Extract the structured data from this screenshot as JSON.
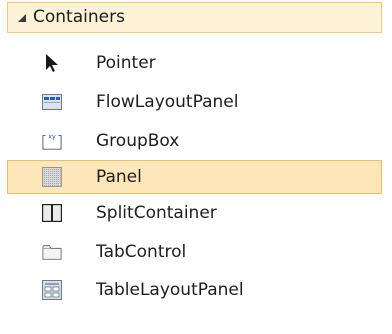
{
  "toolbox": {
    "group": {
      "label": "Containers",
      "expander_icon": "expanded-triangle-icon"
    },
    "items": [
      {
        "label": "Pointer",
        "icon": "pointer-arrow-icon",
        "selected": false
      },
      {
        "label": "FlowLayoutPanel",
        "icon": "flow-layout-panel-icon",
        "selected": false
      },
      {
        "label": "GroupBox",
        "icon": "group-box-icon",
        "selected": false
      },
      {
        "label": "Panel",
        "icon": "panel-icon",
        "selected": true
      },
      {
        "label": "SplitContainer",
        "icon": "split-container-icon",
        "selected": false
      },
      {
        "label": "TabControl",
        "icon": "tab-control-icon",
        "selected": false
      },
      {
        "label": "TableLayoutPanel",
        "icon": "table-layout-panel-icon",
        "selected": false
      }
    ],
    "colors": {
      "header_background": "#fdf2d7",
      "header_border": "#f2c974",
      "selected_background": "#fde7b8",
      "selected_border": "#efbe62",
      "text": "#1e1e1e"
    }
  }
}
